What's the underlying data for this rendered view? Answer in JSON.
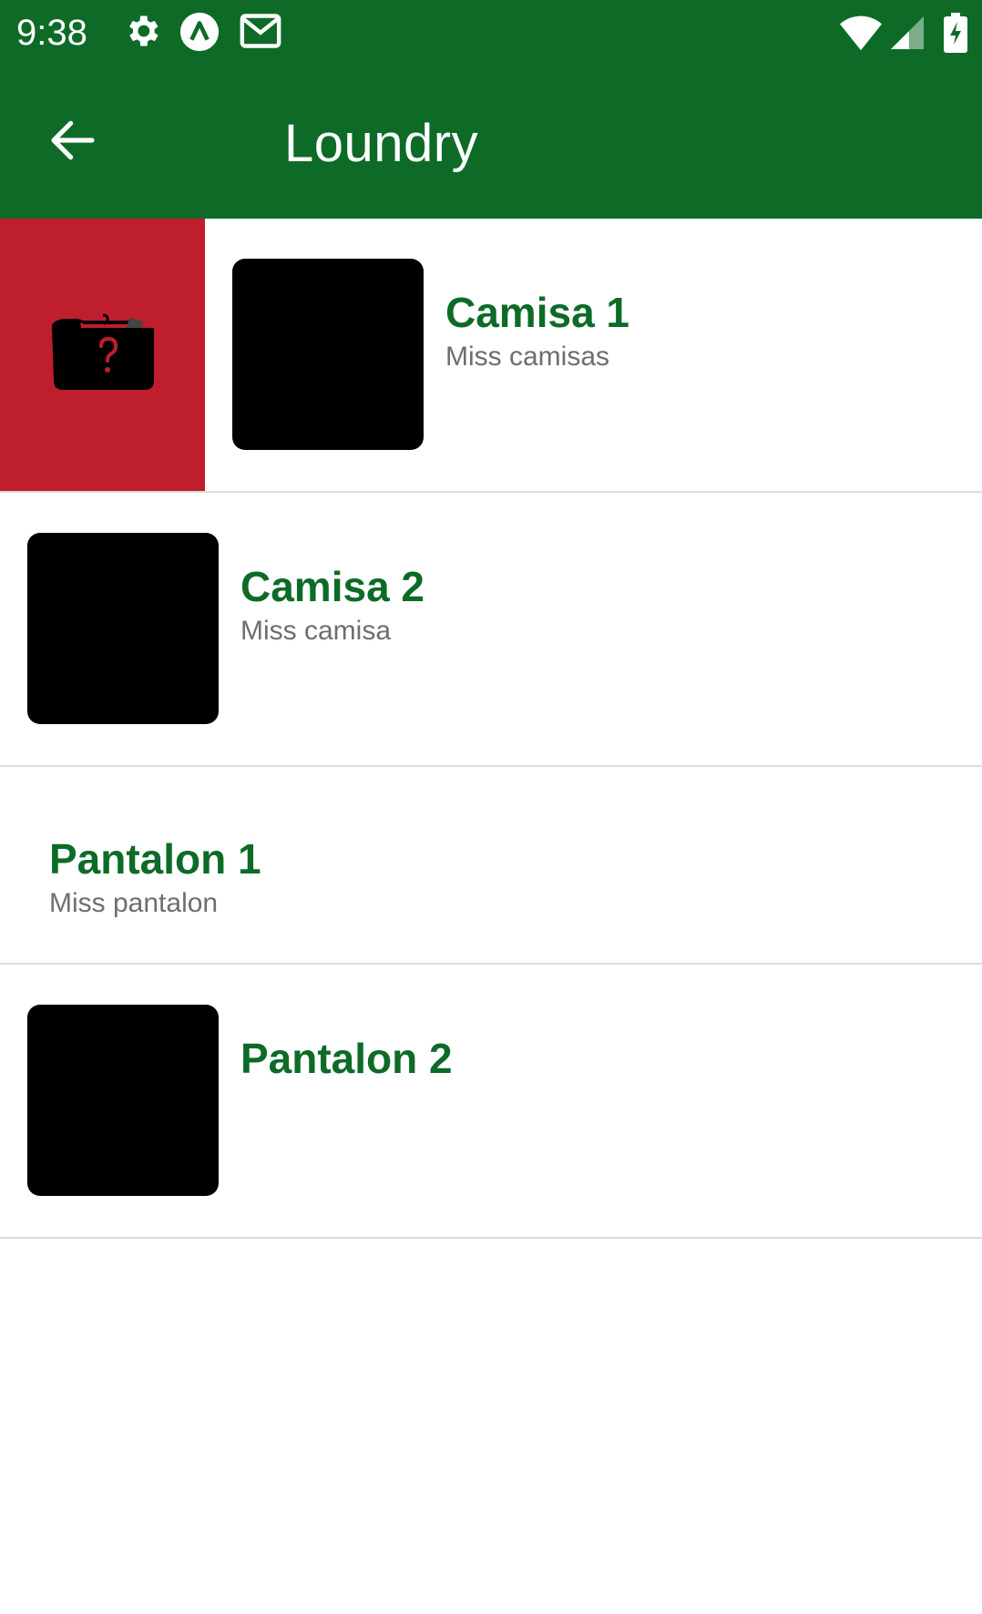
{
  "status_bar": {
    "time": "9:38",
    "left_icons": [
      "gear-icon",
      "a-circle-icon",
      "gmail-icon"
    ],
    "right_icons": [
      "wifi-icon",
      "cell-signal-icon",
      "battery-charging-icon"
    ]
  },
  "app_bar": {
    "back_icon": "arrow-left-icon",
    "title": "Loundry"
  },
  "colors": {
    "primary": "#0d6b27",
    "delete_red": "#be1e2d",
    "subtitle_gray": "#6e6e6e",
    "divider": "#dcdcdc"
  },
  "items": [
    {
      "title": "Camisa 1",
      "subtitle": "Miss camisas",
      "has_image": true,
      "swiped": true,
      "swipe_action_icon": "laundry-basket-icon"
    },
    {
      "title": "Camisa 2",
      "subtitle": "Miss camisa",
      "has_image": true,
      "swiped": false
    },
    {
      "title": "Pantalon 1",
      "subtitle": "Miss pantalon",
      "has_image": false,
      "swiped": false
    },
    {
      "title": "Pantalon 2",
      "subtitle": "",
      "has_image": true,
      "swiped": false
    }
  ]
}
